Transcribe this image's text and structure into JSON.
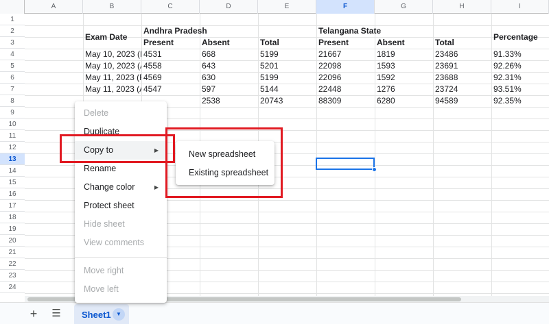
{
  "columns": [
    "A",
    "B",
    "C",
    "D",
    "E",
    "F",
    "G",
    "H",
    "I"
  ],
  "rows": [
    "1",
    "2",
    "3",
    "4",
    "5",
    "6",
    "7",
    "8",
    "9",
    "10",
    "11",
    "12",
    "13",
    "14",
    "15",
    "16",
    "17",
    "18",
    "19",
    "20",
    "21",
    "22",
    "23",
    "24"
  ],
  "selected_column": "F",
  "selected_row": "13",
  "sheet": {
    "headers": {
      "exam_date": "Exam Date",
      "andhra_pradesh": "Andhra Pradesh",
      "telangana_state": "Telangana State",
      "percentage": "Percentage",
      "ap_present": "Present",
      "ap_absent": "Absent",
      "ap_total": "Total",
      "ts_present": "Present",
      "ts_absent": "Absent",
      "ts_total": "Total"
    },
    "data_rows": [
      [
        "May 10, 2023 (F",
        "4531",
        "668",
        "5199",
        "21667",
        "1819",
        "23486",
        "91.33%"
      ],
      [
        "May 10, 2023 (A",
        "4558",
        "643",
        "5201",
        "22098",
        "1593",
        "23691",
        "92.26%"
      ],
      [
        "May 11, 2023 (F",
        "4569",
        "630",
        "5199",
        "22096",
        "1592",
        "23688",
        "92.31%"
      ],
      [
        "May 11, 2023 (A",
        "4547",
        "597",
        "5144",
        "22448",
        "1276",
        "23724",
        "93.51%"
      ]
    ],
    "totals_row": [
      "2538",
      "20743",
      "88309",
      "6280",
      "94589",
      "92.35%"
    ]
  },
  "context_menu": {
    "delete": "Delete",
    "duplicate": "Duplicate",
    "copy_to": "Copy to",
    "rename": "Rename",
    "change_color": "Change color",
    "protect_sheet": "Protect sheet",
    "hide_sheet": "Hide sheet",
    "view_comments": "View comments",
    "move_right": "Move right",
    "move_left": "Move left"
  },
  "submenu": {
    "new_spreadsheet": "New spreadsheet",
    "existing_spreadsheet": "Existing spreadsheet"
  },
  "tabbar": {
    "sheet_name": "Sheet1"
  },
  "icons": {
    "add": "plus-icon",
    "all_sheets": "menu-icon",
    "submenu_arrow": "triangle-right-icon",
    "tab_dropdown": "triangle-down-icon"
  },
  "colors": {
    "highlight_box": "#e11a22",
    "selection": "#1a73e8",
    "sheet_tab_text": "#0b57d0"
  }
}
